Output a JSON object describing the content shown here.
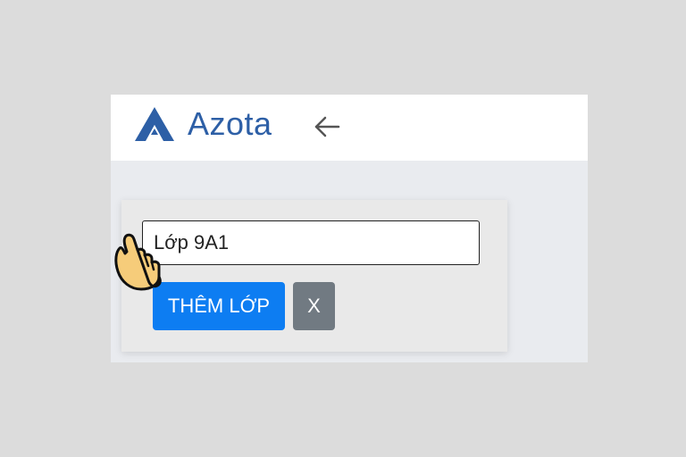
{
  "header": {
    "brand": "Azota",
    "brand_color": "#2d5fa6"
  },
  "form": {
    "class_name_value": "Lớp 9A1",
    "add_class_label": "THÊM LỚP",
    "close_label": "X"
  },
  "colors": {
    "primary": "#0d7df2",
    "secondary": "#717a82",
    "page_background": "#e9ebef"
  },
  "icons": {
    "logo": "azota-logo-icon",
    "back": "arrow-left-icon",
    "pointer": "pointing-hand-icon"
  }
}
